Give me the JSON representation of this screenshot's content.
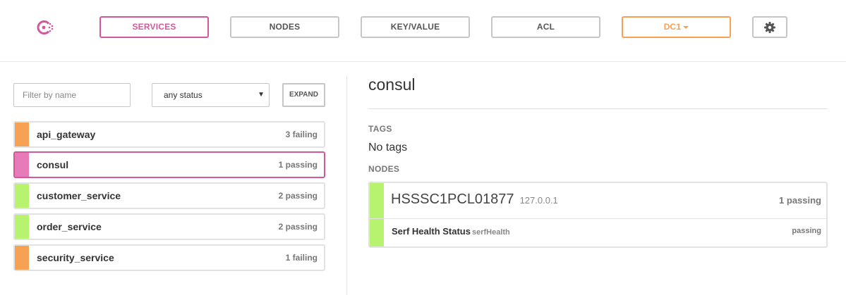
{
  "nav": {
    "services_label": "SERVICES",
    "nodes_label": "NODES",
    "kv_label": "KEY/VALUE",
    "acl_label": "ACL",
    "dc_label": "DC1",
    "settings_icon": "gear-icon",
    "logo_icon": "consul-logo-icon"
  },
  "sidebar": {
    "filter_placeholder": "Filter by name",
    "status_select": "any status",
    "expand_label": "EXPAND",
    "services": [
      {
        "name": "api_gateway",
        "status": "3 failing",
        "color": "#f6a154"
      },
      {
        "name": "consul",
        "status": "1 passing",
        "color": "#e67bb8",
        "selected": true
      },
      {
        "name": "customer_service",
        "status": "2 passing",
        "color": "#b7f36f"
      },
      {
        "name": "order_service",
        "status": "2 passing",
        "color": "#b7f36f"
      },
      {
        "name": "security_service",
        "status": "1 failing",
        "color": "#f6a154"
      }
    ]
  },
  "detail": {
    "title": "consul",
    "tags_label": "TAGS",
    "tags_value": "No tags",
    "nodes_label": "NODES",
    "node": {
      "name": "HSSSC1PCL01877",
      "ip": "127.0.0.1",
      "status": "1 passing",
      "check": {
        "name": "Serf Health Status",
        "id": "serfHealth",
        "status": "passing"
      }
    }
  },
  "colors": {
    "brand": "#d5579b",
    "warning": "#f6a154",
    "passing": "#b7f36f"
  }
}
